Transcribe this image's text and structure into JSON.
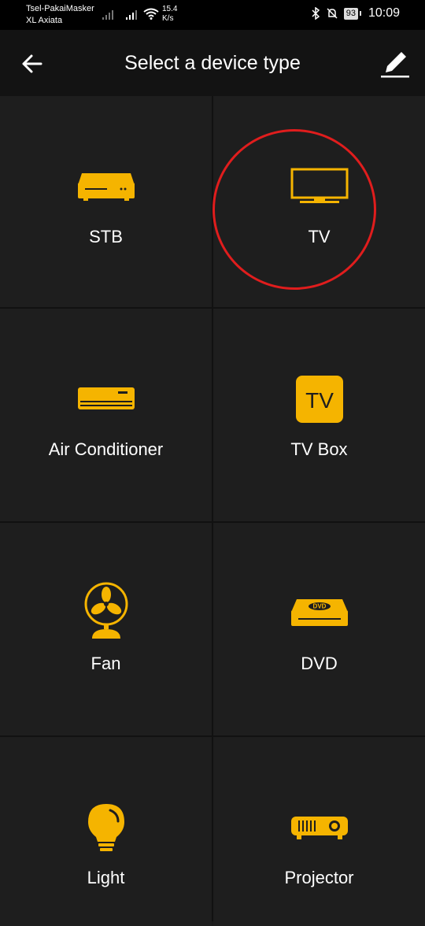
{
  "status_bar": {
    "carrier_1": "Tsel-PakaiMasker",
    "carrier_2": "XL Axiata",
    "speed_value": "15.4",
    "speed_unit": "K/s",
    "battery": "93",
    "time": "10:09"
  },
  "toolbar": {
    "title": "Select a device type"
  },
  "devices": [
    {
      "label": "STB",
      "icon": "set-top-box-icon"
    },
    {
      "label": "TV",
      "icon": "tv-icon",
      "highlighted": true
    },
    {
      "label": "Air Conditioner",
      "icon": "air-conditioner-icon"
    },
    {
      "label": "TV Box",
      "icon": "tv-box-icon",
      "icon_text": "TV"
    },
    {
      "label": "Fan",
      "icon": "fan-icon"
    },
    {
      "label": "DVD",
      "icon": "dvd-icon",
      "icon_text": "DVD"
    },
    {
      "label": "Light",
      "icon": "light-bulb-icon"
    },
    {
      "label": "Projector",
      "icon": "projector-icon"
    }
  ],
  "colors": {
    "accent": "#f5b400",
    "highlight": "#e01d1d",
    "background": "#1e1e1e"
  }
}
